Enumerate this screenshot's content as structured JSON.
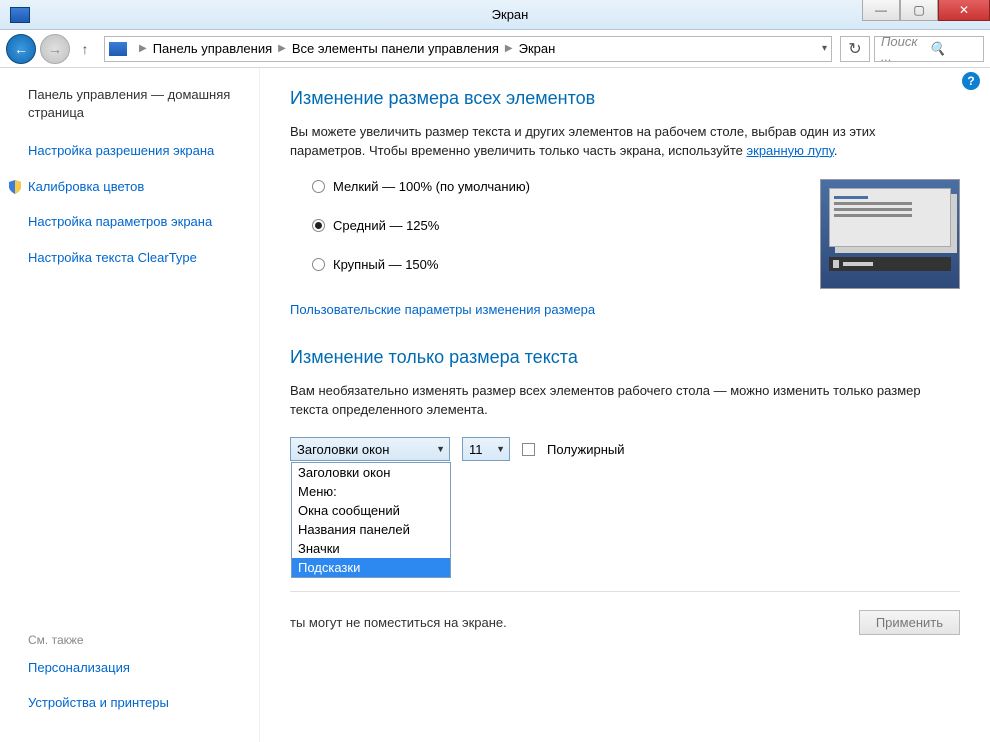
{
  "window": {
    "title": "Экран",
    "minimize": "—",
    "maximize": "▢",
    "close": "✕"
  },
  "nav": {
    "breadcrumb": {
      "item1": "Панель управления",
      "item2": "Все элементы панели управления",
      "item3": "Экран"
    },
    "search_placeholder": "Поиск ..."
  },
  "sidebar": {
    "home": "Панель управления — домашняя страница",
    "links": [
      "Настройка разрешения экрана",
      "Калибровка цветов",
      "Настройка параметров экрана",
      "Настройка текста ClearType"
    ],
    "also_hdr": "См. также",
    "also": [
      "Персонализация",
      "Устройства и принтеры"
    ]
  },
  "main": {
    "h1": "Изменение размера всех элементов",
    "desc_a": "Вы можете увеличить размер текста и других элементов на рабочем столе, выбрав один из этих параметров. Чтобы временно увеличить только часть экрана, используйте ",
    "desc_link": "экранную лупу",
    "desc_b": ".",
    "radios": [
      "Мелкий — 100% (по умолчанию)",
      "Средний — 125%",
      "Крупный — 150%"
    ],
    "custom_link": "Пользовательские параметры изменения размера",
    "h2": "Изменение только размера текста",
    "desc2": "Вам необязательно изменять размер всех элементов рабочего стола — можно изменить только размер текста определенного элемента.",
    "sel_value": "Заголовки окон",
    "size_value": "11",
    "bold_label": "Полужирный",
    "options": [
      "Заголовки окон",
      "Меню:",
      "Окна сообщений",
      "Названия панелей",
      "Значки",
      "Подсказки"
    ],
    "note_tail": "ты могут не поместиться на экране.",
    "apply": "Применить"
  }
}
